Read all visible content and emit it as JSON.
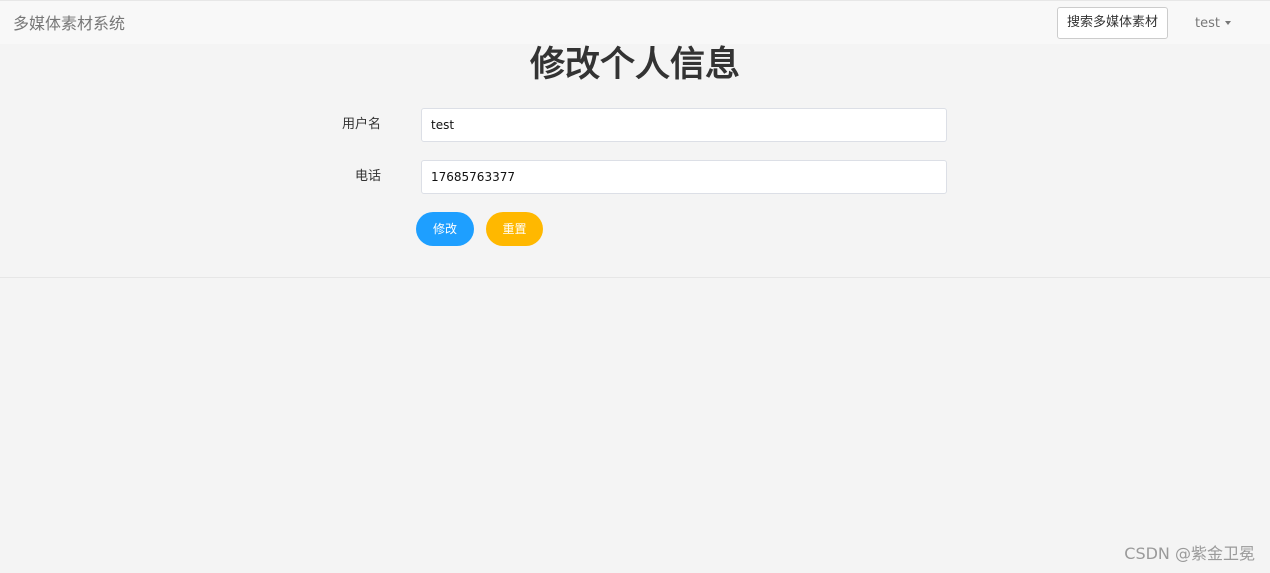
{
  "navbar": {
    "brand": "多媒体素材系统",
    "search_button": "搜索多媒体素材",
    "user": "test"
  },
  "form": {
    "title": "修改个人信息",
    "username_label": "用户名",
    "username_value": "test",
    "phone_label": "电话",
    "phone_value": "17685763377",
    "modify_button": "修改",
    "reset_button": "重置"
  },
  "watermark": "CSDN @紫金卫冕",
  "colors": {
    "primary_button": "#1e9fff",
    "reset_button": "#ffb800",
    "background": "#f4f4f4"
  }
}
